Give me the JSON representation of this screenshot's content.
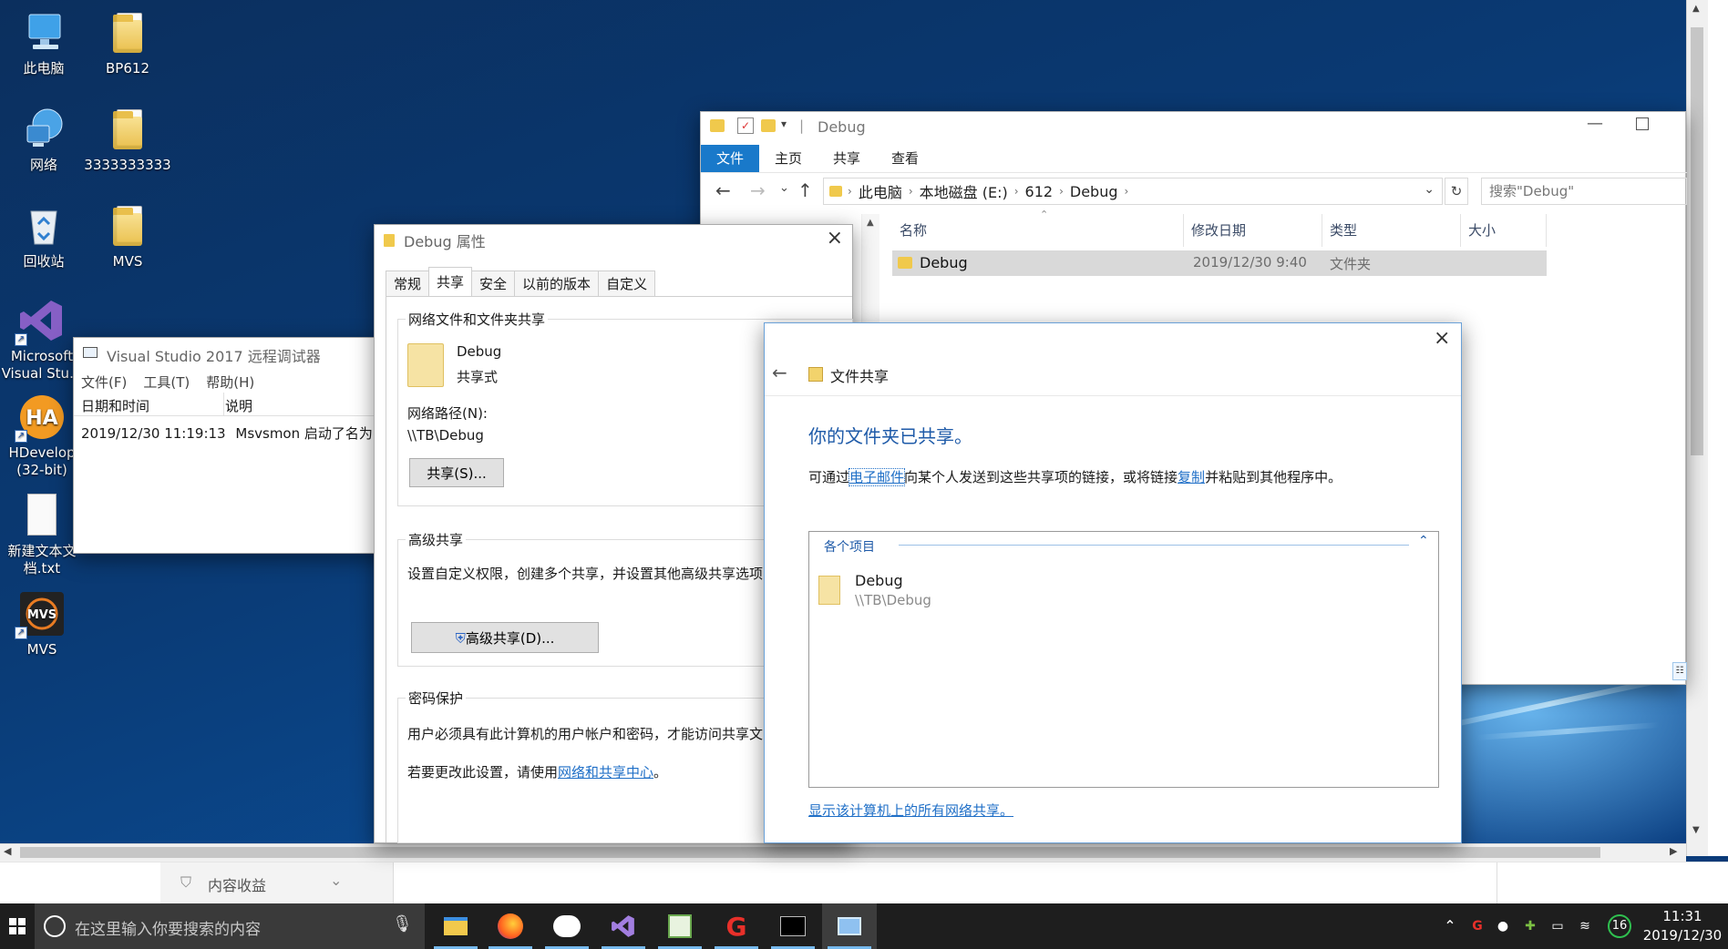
{
  "desktop": {
    "icons": [
      {
        "label": "此电脑",
        "icon": "computer-icon"
      },
      {
        "label": "BP612",
        "icon": "folder-icon"
      },
      {
        "label": "网络",
        "icon": "network-icon"
      },
      {
        "label": "3333333333",
        "icon": "folder-icon"
      },
      {
        "label": "回收站",
        "icon": "recycle-bin-icon"
      },
      {
        "label": "MVS",
        "icon": "folder-icon"
      },
      {
        "label": "Microsoft Visual Stu...",
        "icon": "visual-studio-icon"
      },
      {
        "label": "HDevelop (32-bit)",
        "icon": "hdevelop-icon"
      },
      {
        "label": "新建文本文档.txt",
        "icon": "text-file-icon"
      },
      {
        "label": "MVS",
        "icon": "mvs-app-icon"
      }
    ]
  },
  "explorer": {
    "title": "Debug",
    "tabs": [
      "文件",
      "主页",
      "共享",
      "查看"
    ],
    "address": [
      "此电脑",
      "本地磁盘 (E:)",
      "612",
      "Debug"
    ],
    "search_placeholder": "搜索\"Debug\"",
    "columns": [
      "名称",
      "修改日期",
      "类型",
      "大小"
    ],
    "rows": [
      {
        "name": "Debug",
        "date": "2019/12/30 9:40",
        "type": "文件夹",
        "size": ""
      }
    ]
  },
  "vs_debugger": {
    "title": "Visual Studio 2017 远程调试器",
    "menu": [
      "文件(F)",
      "工具(T)",
      "帮助(H)"
    ],
    "columns": [
      "日期和时间",
      "说明"
    ],
    "rows": [
      {
        "time": "2019/12/30 11:19:13",
        "desc": "Msvsmon 启动了名为\"T"
      }
    ]
  },
  "properties": {
    "title": "Debug 属性",
    "tabs": [
      "常规",
      "共享",
      "安全",
      "以前的版本",
      "自定义"
    ],
    "network_group_title": "网络文件和文件夹共享",
    "folder_name": "Debug",
    "share_state": "共享式",
    "network_path_label": "网络路径(N):",
    "network_path": "\\\\TB\\Debug",
    "share_button": "共享(S)...",
    "advanced_group_title": "高级共享",
    "advanced_desc": "设置自定义权限，创建多个共享，并设置其他高级共享选项",
    "advanced_button": "高级共享(D)...",
    "password_group_title": "密码保护",
    "password_desc": "用户必须具有此计算机的用户帐户和密码，才能访问共享文",
    "change_prefix": "若要更改此设置，请使用",
    "change_link": "网络和共享中心",
    "change_suffix": "。"
  },
  "file_sharing": {
    "nav_title": "文件共享",
    "heading": "你的文件夹已共享。",
    "desc_parts": [
      "可通过",
      "电子邮件",
      "向某个人发送到这些共享项的链接，或将链接",
      "复制",
      "并粘贴到其他程序中。"
    ],
    "group_label": "各个项目",
    "item_name": "Debug",
    "item_path": "\\\\TB\\Debug",
    "show_all_link": "显示该计算机上的所有网络共享。"
  },
  "bottom_strip": {
    "label": "内容收益"
  },
  "taskbar": {
    "search_placeholder": "在这里输入你要搜索的内容",
    "time": "11:31",
    "date": "2019/12/30",
    "badge": "16"
  },
  "colors": {
    "accent": "#1979ca",
    "link": "#1f6fc7",
    "heading_blue": "#1e5aa8",
    "taskbar": "#1e1e1e"
  }
}
